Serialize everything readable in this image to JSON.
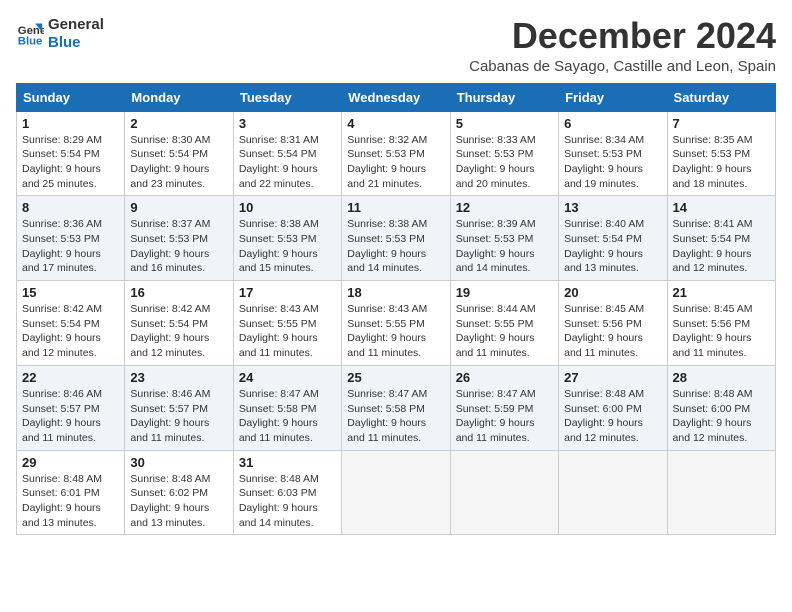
{
  "logo": {
    "line1": "General",
    "line2": "Blue"
  },
  "title": "December 2024",
  "subtitle": "Cabanas de Sayago, Castille and Leon, Spain",
  "weekdays": [
    "Sunday",
    "Monday",
    "Tuesday",
    "Wednesday",
    "Thursday",
    "Friday",
    "Saturday"
  ],
  "weeks": [
    [
      {
        "day": "1",
        "info": "Sunrise: 8:29 AM\nSunset: 5:54 PM\nDaylight: 9 hours\nand 25 minutes."
      },
      {
        "day": "2",
        "info": "Sunrise: 8:30 AM\nSunset: 5:54 PM\nDaylight: 9 hours\nand 23 minutes."
      },
      {
        "day": "3",
        "info": "Sunrise: 8:31 AM\nSunset: 5:54 PM\nDaylight: 9 hours\nand 22 minutes."
      },
      {
        "day": "4",
        "info": "Sunrise: 8:32 AM\nSunset: 5:53 PM\nDaylight: 9 hours\nand 21 minutes."
      },
      {
        "day": "5",
        "info": "Sunrise: 8:33 AM\nSunset: 5:53 PM\nDaylight: 9 hours\nand 20 minutes."
      },
      {
        "day": "6",
        "info": "Sunrise: 8:34 AM\nSunset: 5:53 PM\nDaylight: 9 hours\nand 19 minutes."
      },
      {
        "day": "7",
        "info": "Sunrise: 8:35 AM\nSunset: 5:53 PM\nDaylight: 9 hours\nand 18 minutes."
      }
    ],
    [
      {
        "day": "8",
        "info": "Sunrise: 8:36 AM\nSunset: 5:53 PM\nDaylight: 9 hours\nand 17 minutes."
      },
      {
        "day": "9",
        "info": "Sunrise: 8:37 AM\nSunset: 5:53 PM\nDaylight: 9 hours\nand 16 minutes."
      },
      {
        "day": "10",
        "info": "Sunrise: 8:38 AM\nSunset: 5:53 PM\nDaylight: 9 hours\nand 15 minutes."
      },
      {
        "day": "11",
        "info": "Sunrise: 8:38 AM\nSunset: 5:53 PM\nDaylight: 9 hours\nand 14 minutes."
      },
      {
        "day": "12",
        "info": "Sunrise: 8:39 AM\nSunset: 5:53 PM\nDaylight: 9 hours\nand 14 minutes."
      },
      {
        "day": "13",
        "info": "Sunrise: 8:40 AM\nSunset: 5:54 PM\nDaylight: 9 hours\nand 13 minutes."
      },
      {
        "day": "14",
        "info": "Sunrise: 8:41 AM\nSunset: 5:54 PM\nDaylight: 9 hours\nand 12 minutes."
      }
    ],
    [
      {
        "day": "15",
        "info": "Sunrise: 8:42 AM\nSunset: 5:54 PM\nDaylight: 9 hours\nand 12 minutes."
      },
      {
        "day": "16",
        "info": "Sunrise: 8:42 AM\nSunset: 5:54 PM\nDaylight: 9 hours\nand 12 minutes."
      },
      {
        "day": "17",
        "info": "Sunrise: 8:43 AM\nSunset: 5:55 PM\nDaylight: 9 hours\nand 11 minutes."
      },
      {
        "day": "18",
        "info": "Sunrise: 8:43 AM\nSunset: 5:55 PM\nDaylight: 9 hours\nand 11 minutes."
      },
      {
        "day": "19",
        "info": "Sunrise: 8:44 AM\nSunset: 5:55 PM\nDaylight: 9 hours\nand 11 minutes."
      },
      {
        "day": "20",
        "info": "Sunrise: 8:45 AM\nSunset: 5:56 PM\nDaylight: 9 hours\nand 11 minutes."
      },
      {
        "day": "21",
        "info": "Sunrise: 8:45 AM\nSunset: 5:56 PM\nDaylight: 9 hours\nand 11 minutes."
      }
    ],
    [
      {
        "day": "22",
        "info": "Sunrise: 8:46 AM\nSunset: 5:57 PM\nDaylight: 9 hours\nand 11 minutes."
      },
      {
        "day": "23",
        "info": "Sunrise: 8:46 AM\nSunset: 5:57 PM\nDaylight: 9 hours\nand 11 minutes."
      },
      {
        "day": "24",
        "info": "Sunrise: 8:47 AM\nSunset: 5:58 PM\nDaylight: 9 hours\nand 11 minutes."
      },
      {
        "day": "25",
        "info": "Sunrise: 8:47 AM\nSunset: 5:58 PM\nDaylight: 9 hours\nand 11 minutes."
      },
      {
        "day": "26",
        "info": "Sunrise: 8:47 AM\nSunset: 5:59 PM\nDaylight: 9 hours\nand 11 minutes."
      },
      {
        "day": "27",
        "info": "Sunrise: 8:48 AM\nSunset: 6:00 PM\nDaylight: 9 hours\nand 12 minutes."
      },
      {
        "day": "28",
        "info": "Sunrise: 8:48 AM\nSunset: 6:00 PM\nDaylight: 9 hours\nand 12 minutes."
      }
    ],
    [
      {
        "day": "29",
        "info": "Sunrise: 8:48 AM\nSunset: 6:01 PM\nDaylight: 9 hours\nand 13 minutes."
      },
      {
        "day": "30",
        "info": "Sunrise: 8:48 AM\nSunset: 6:02 PM\nDaylight: 9 hours\nand 13 minutes."
      },
      {
        "day": "31",
        "info": "Sunrise: 8:48 AM\nSunset: 6:03 PM\nDaylight: 9 hours\nand 14 minutes."
      },
      null,
      null,
      null,
      null
    ]
  ]
}
